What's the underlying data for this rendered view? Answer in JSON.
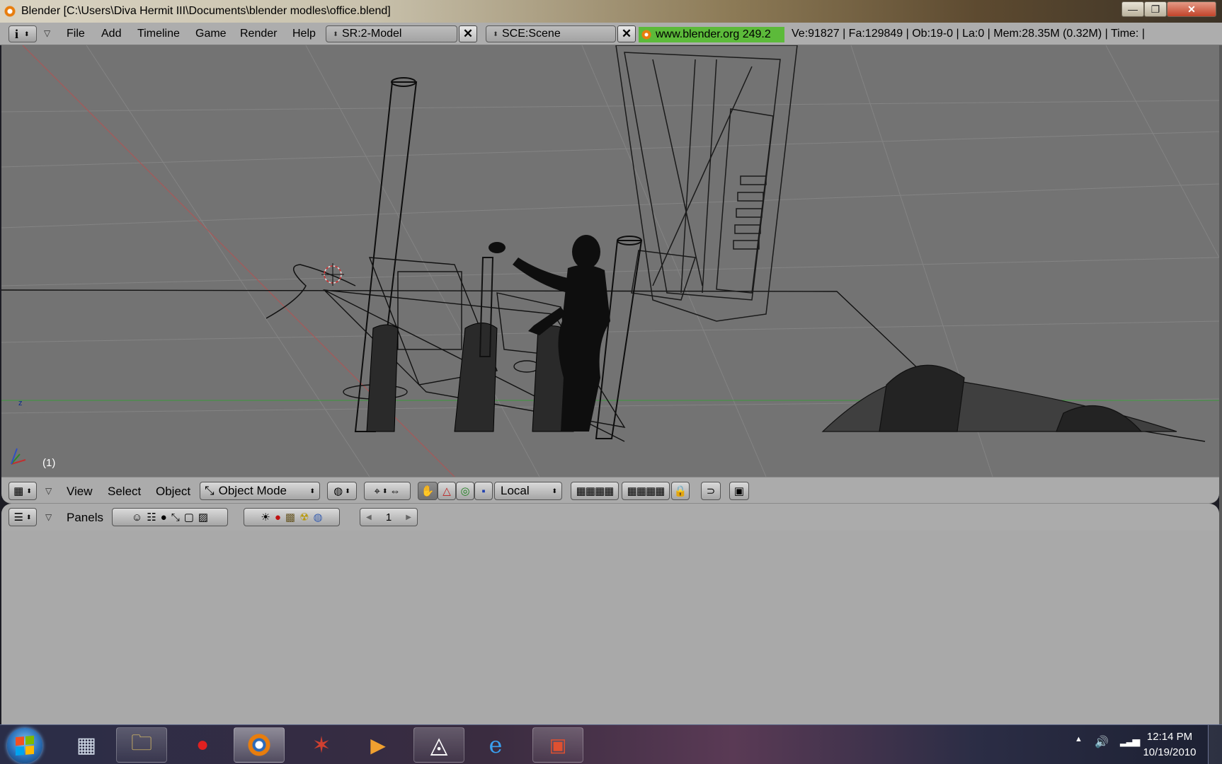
{
  "window": {
    "title": "Blender [C:\\Users\\Diva Hermit III\\Documents\\blender modles\\office.blend]",
    "controls": {
      "minimize": "—",
      "maximize": "❐",
      "close": "✕"
    }
  },
  "info_header": {
    "menus": [
      "File",
      "Add",
      "Timeline",
      "Game",
      "Render",
      "Help"
    ],
    "screen_field": "SR:2-Model",
    "scene_field": "SCE:Scene",
    "website": "www.blender.org 249.2",
    "stats": "Ve:91827 | Fa:129849 | Ob:19-0 | La:0  | Mem:28.35M (0.32M)  | Time: |"
  },
  "viewport": {
    "frame_label": "(1)",
    "axis_z_label": "z"
  },
  "view3d_header": {
    "menus": [
      "View",
      "Select",
      "Object"
    ],
    "mode": "Object Mode",
    "pivot": "Local"
  },
  "buttons_header": {
    "panels_label": "Panels",
    "page_number": "1"
  },
  "taskbar": {
    "clock_time": "12:14 PM",
    "clock_date": "10/19/2010"
  },
  "colors": {
    "viewport_bg": "#737373",
    "header_bg": "#ababab",
    "website_bg": "#5cba3a"
  }
}
